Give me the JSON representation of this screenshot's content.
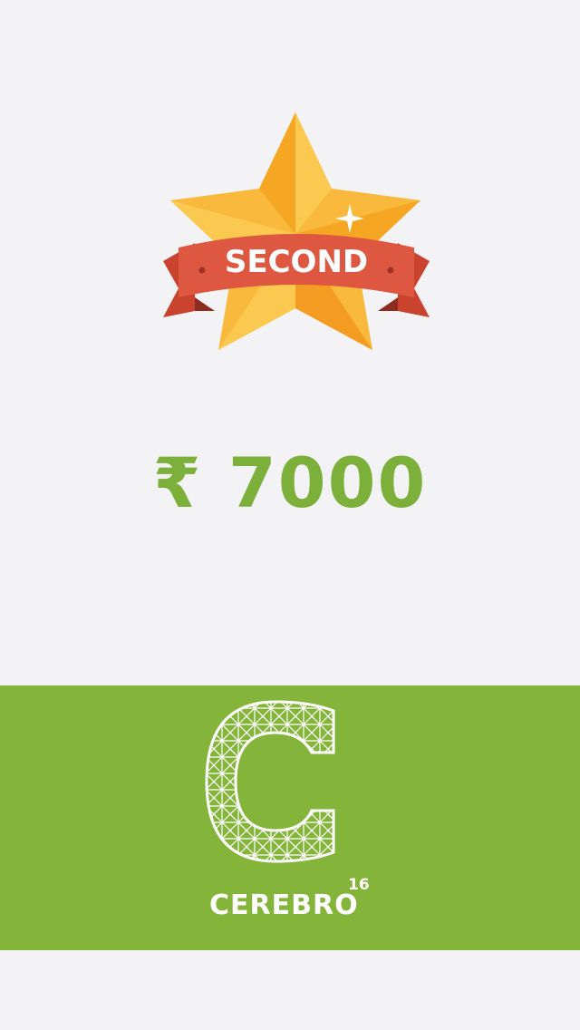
{
  "badge": {
    "label": "SECOND",
    "icon": "star-ribbon-badge-icon",
    "colors": {
      "star": "#f8b93c",
      "star_dark": "#f39c21",
      "ribbon": "#de5740",
      "ribbon_dark": "#a8372a"
    }
  },
  "prize": {
    "amount": "₹ 7000"
  },
  "footer": {
    "background": "#84b43a",
    "logo": {
      "icon": "cerebro-c-mesh-logo-icon",
      "name": "CEREBRO",
      "superscript": "16"
    }
  },
  "colors": {
    "page_bg": "#f3f3f5",
    "accent_green": "#7db03a"
  }
}
